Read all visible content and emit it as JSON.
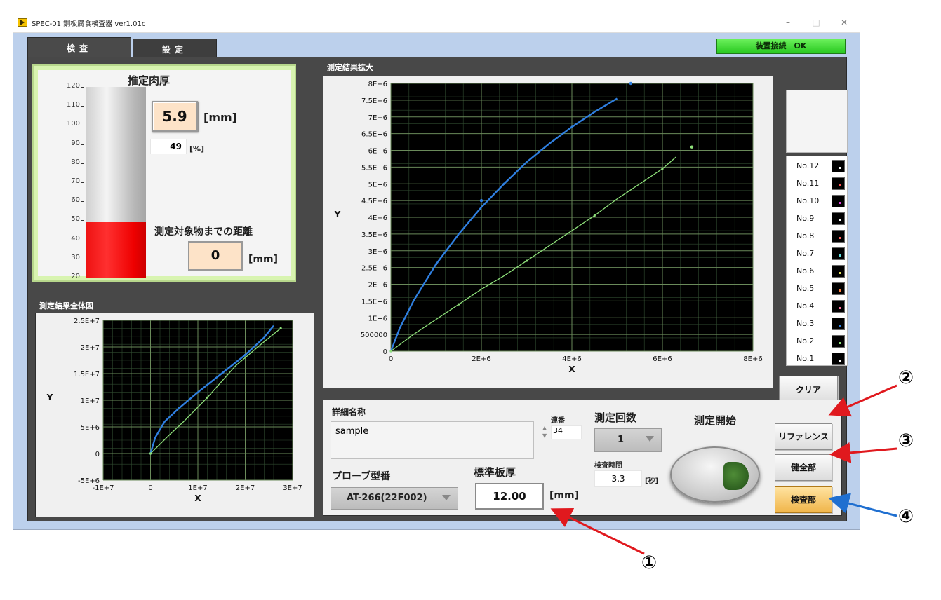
{
  "window": {
    "title": "SPEC-01 鋼板腐食検査器 ver1.01c",
    "minimize": "–",
    "maximize": "□",
    "close": "✕"
  },
  "tabs": {
    "inspect": "検査",
    "settings": "設定"
  },
  "status": {
    "text": "装置接続　OK",
    "color": "#3fe02c"
  },
  "thickness": {
    "title": "推定肉厚",
    "scale_ticks": [
      "120",
      "110",
      "100",
      "90",
      "80",
      "70",
      "60",
      "50",
      "40",
      "30",
      "20"
    ],
    "scale_min": 20,
    "scale_max": 120,
    "fill_level": 49,
    "value": "5.9",
    "unit": "[mm]",
    "percent": "49",
    "percent_unit": "[%]",
    "distance_label": "測定対象物までの距離",
    "distance_value": "0",
    "distance_unit": "[mm]"
  },
  "overview_graph": {
    "caption": "測定結果全体図",
    "y_ticks": [
      "2.5E+7",
      "2E+7",
      "1.5E+7",
      "1E+7",
      "5E+6",
      "0",
      "-5E+6"
    ],
    "x_ticks": [
      "-1E+7",
      "0",
      "1E+7",
      "2E+7",
      "3E+7"
    ],
    "xlabel": "X",
    "ylabel": "Y"
  },
  "zoom_graph": {
    "caption": "測定結果拡大",
    "y_ticks": [
      "8E+6",
      "7.5E+6",
      "7E+6",
      "6.5E+6",
      "6E+6",
      "5.5E+6",
      "5E+6",
      "4.5E+6",
      "4E+6",
      "3.5E+6",
      "3E+6",
      "2.5E+6",
      "2E+6",
      "1.5E+6",
      "1E+6",
      "500000",
      "0"
    ],
    "x_ticks": [
      "0",
      "2E+6",
      "4E+6",
      "6E+6",
      "8E+6"
    ],
    "xlabel": "X",
    "ylabel": "Y"
  },
  "chart_data": [
    {
      "type": "line",
      "xlabel": "X",
      "ylabel": "Y",
      "xlim": [
        -10000000,
        30000000
      ],
      "ylim": [
        -5000000,
        25000000
      ],
      "grid": true,
      "series": [
        {
          "name": "No.3",
          "color": "#2f7fe0",
          "x": [
            0,
            1000000,
            3000000,
            6000000,
            10000000,
            15000000,
            20000000,
            24000000,
            26000000
          ],
          "y": [
            0,
            3000000,
            6000000,
            8500000,
            11500000,
            15000000,
            18500000,
            21800000,
            24000000
          ]
        },
        {
          "name": "No.2",
          "color": "#8ee07a",
          "x": [
            0,
            4000000,
            7000000,
            12000000,
            18000000,
            24000000,
            27500000
          ],
          "y": [
            0,
            3500000,
            6000000,
            10500000,
            16500000,
            21000000,
            23500000
          ]
        }
      ]
    },
    {
      "type": "line",
      "xlabel": "X",
      "ylabel": "Y",
      "xlim": [
        0,
        8000000
      ],
      "ylim": [
        0,
        8000000
      ],
      "grid": true,
      "series": [
        {
          "name": "No.3",
          "color": "#2f7fe0",
          "x": [
            0,
            200000,
            500000,
            1000000,
            1500000,
            2000000,
            2500000,
            3000000,
            3500000,
            4000000,
            4500000,
            5000000
          ],
          "y": [
            0,
            700000,
            1500000,
            2600000,
            3500000,
            4300000,
            5000000,
            5650000,
            6200000,
            6700000,
            7150000,
            7550000
          ]
        },
        {
          "name": "No.2",
          "color": "#8ee07a",
          "x": [
            0,
            500000,
            1000000,
            1500000,
            2000000,
            2500000,
            3000000,
            3500000,
            4000000,
            4500000,
            5000000,
            5500000,
            6000000,
            6300000
          ],
          "y": [
            0,
            500000,
            950000,
            1400000,
            1850000,
            2250000,
            2700000,
            3150000,
            3600000,
            4050000,
            4550000,
            5000000,
            5450000,
            5800000
          ]
        }
      ],
      "points": [
        {
          "series": "No.3",
          "x": 2000000,
          "y": 4500000
        },
        {
          "series": "No.3",
          "x": 5300000,
          "y": 8000000
        },
        {
          "series": "No.2",
          "x": 6650000,
          "y": 6100000
        }
      ]
    }
  ],
  "legend": {
    "items": [
      {
        "label": "No.12",
        "color": "#ffffff"
      },
      {
        "label": "No.11",
        "color": "#ff5050"
      },
      {
        "label": "No.10",
        "color": "#e040e0"
      },
      {
        "label": "No.9",
        "color": "#ffffff"
      },
      {
        "label": "No.8",
        "color": "#ff6060"
      },
      {
        "label": "No.7",
        "color": "#60e0e0"
      },
      {
        "label": "No.6",
        "color": "#e0e060"
      },
      {
        "label": "No.5",
        "color": "#ff8040"
      },
      {
        "label": "No.4",
        "color": "#ff70a0"
      },
      {
        "label": "No.3",
        "color": "#2f7fe0"
      },
      {
        "label": "No.2",
        "color": "#8ee07a"
      },
      {
        "label": "No.1",
        "color": "#ffffff"
      }
    ],
    "clear_button": "クリア"
  },
  "side_buttons": {
    "reference": "リファレンス",
    "healthy": "健全部",
    "inspection": "検査部"
  },
  "controls": {
    "detail_name_label": "詳細名称",
    "detail_name_value": "sample",
    "serial_label": "連番",
    "serial_value": "34",
    "count_label": "測定回数",
    "count_value": "1",
    "time_label": "検査時間",
    "time_value": "3.3",
    "time_unit": "[秒]",
    "start_label": "測定開始",
    "probe_label": "プローブ型番",
    "probe_value": "AT-266(22F002)",
    "std_label": "標準板厚",
    "std_value": "12.00",
    "std_unit": "[mm]"
  },
  "annotations": {
    "m1": "①",
    "m2": "②",
    "m3": "③",
    "m4": "④",
    "red": "#e0191e",
    "blue": "#1f6fd0"
  }
}
